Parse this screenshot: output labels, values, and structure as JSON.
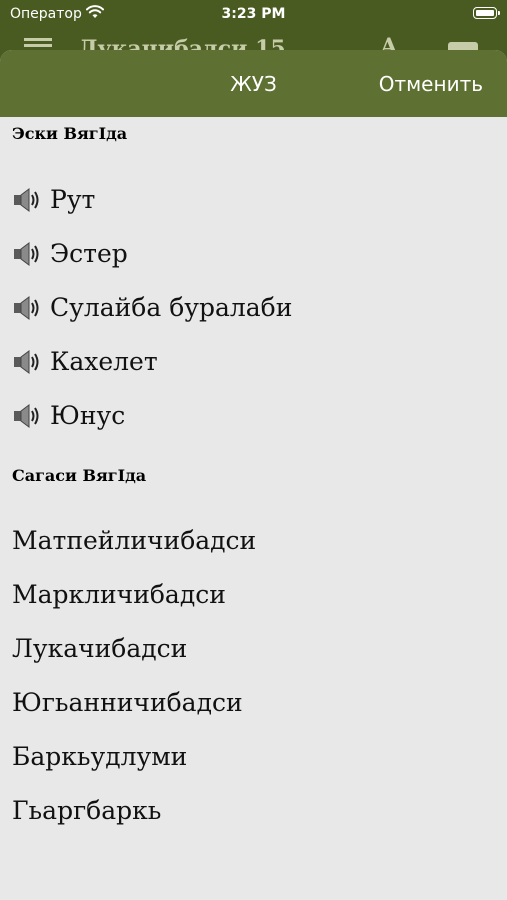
{
  "status_bar": {
    "carrier": "Оператор",
    "time": "3:23 PM",
    "wifi_icon": "wifi-icon",
    "battery_icon": "battery-icon"
  },
  "background_header": {
    "title": "Лукачибадси 15",
    "text_icon": "А"
  },
  "sheet": {
    "title": "ЖУЗ",
    "cancel_label": "Отменить"
  },
  "sections": [
    {
      "header": "Эски ВягIда",
      "books": [
        {
          "label": "Рут",
          "has_audio": true
        },
        {
          "label": "Эстер",
          "has_audio": true
        },
        {
          "label": "Сулайба буралаби",
          "has_audio": true
        },
        {
          "label": "Кахелет",
          "has_audio": true
        },
        {
          "label": "Юнус",
          "has_audio": true
        }
      ]
    },
    {
      "header": "Сагаси ВягIда",
      "books": [
        {
          "label": "Матпейличибадси",
          "has_audio": false
        },
        {
          "label": "Маркличибадси",
          "has_audio": false
        },
        {
          "label": "Лукачибадси",
          "has_audio": false
        },
        {
          "label": "Югьанничибадси",
          "has_audio": false
        },
        {
          "label": "Баркьудлуми",
          "has_audio": false
        },
        {
          "label": "Гьаргбаркь",
          "has_audio": false
        }
      ]
    }
  ],
  "colors": {
    "header_green": "#5e7032",
    "page_green": "#4a5b22",
    "sheet_background": "#e8e8e8"
  }
}
